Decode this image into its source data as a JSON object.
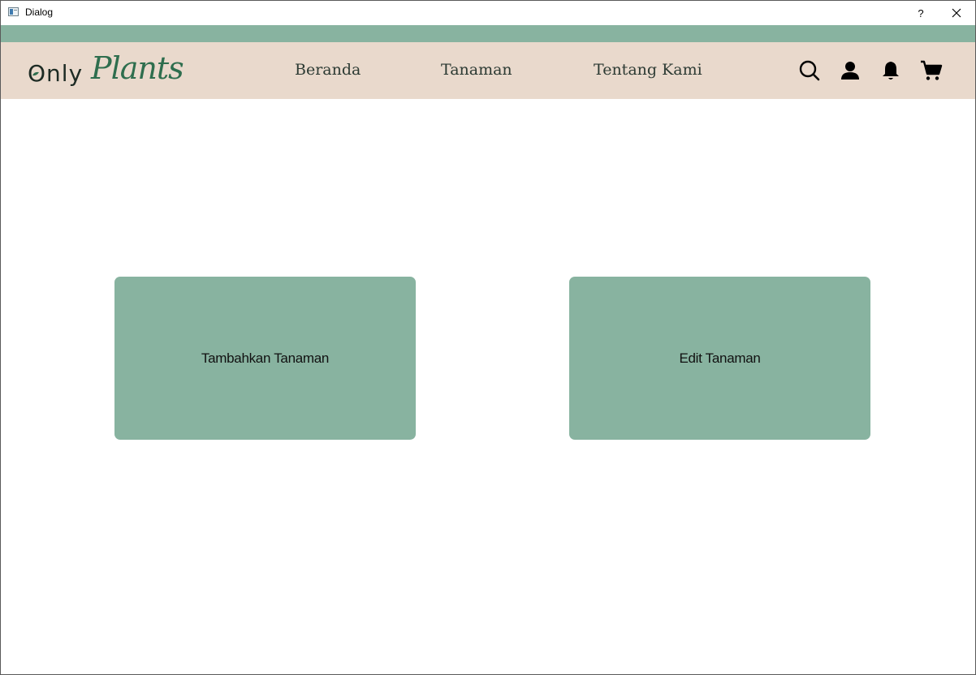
{
  "window": {
    "title": "Dialog",
    "help_label": "?"
  },
  "brand": {
    "logo_part1": "Only",
    "logo_part2": "Plants",
    "primary_green": "#88b3a0",
    "nav_background": "#e9d9cc",
    "logo_green": "#2e6e4e"
  },
  "nav": {
    "links": [
      "Beranda",
      "Tanaman",
      "Tentang Kami"
    ],
    "icons": [
      "search-icon",
      "user-icon",
      "bell-icon",
      "cart-icon"
    ]
  },
  "actions": {
    "add_label": "Tambahkan Tanaman",
    "edit_label": "Edit Tanaman"
  }
}
